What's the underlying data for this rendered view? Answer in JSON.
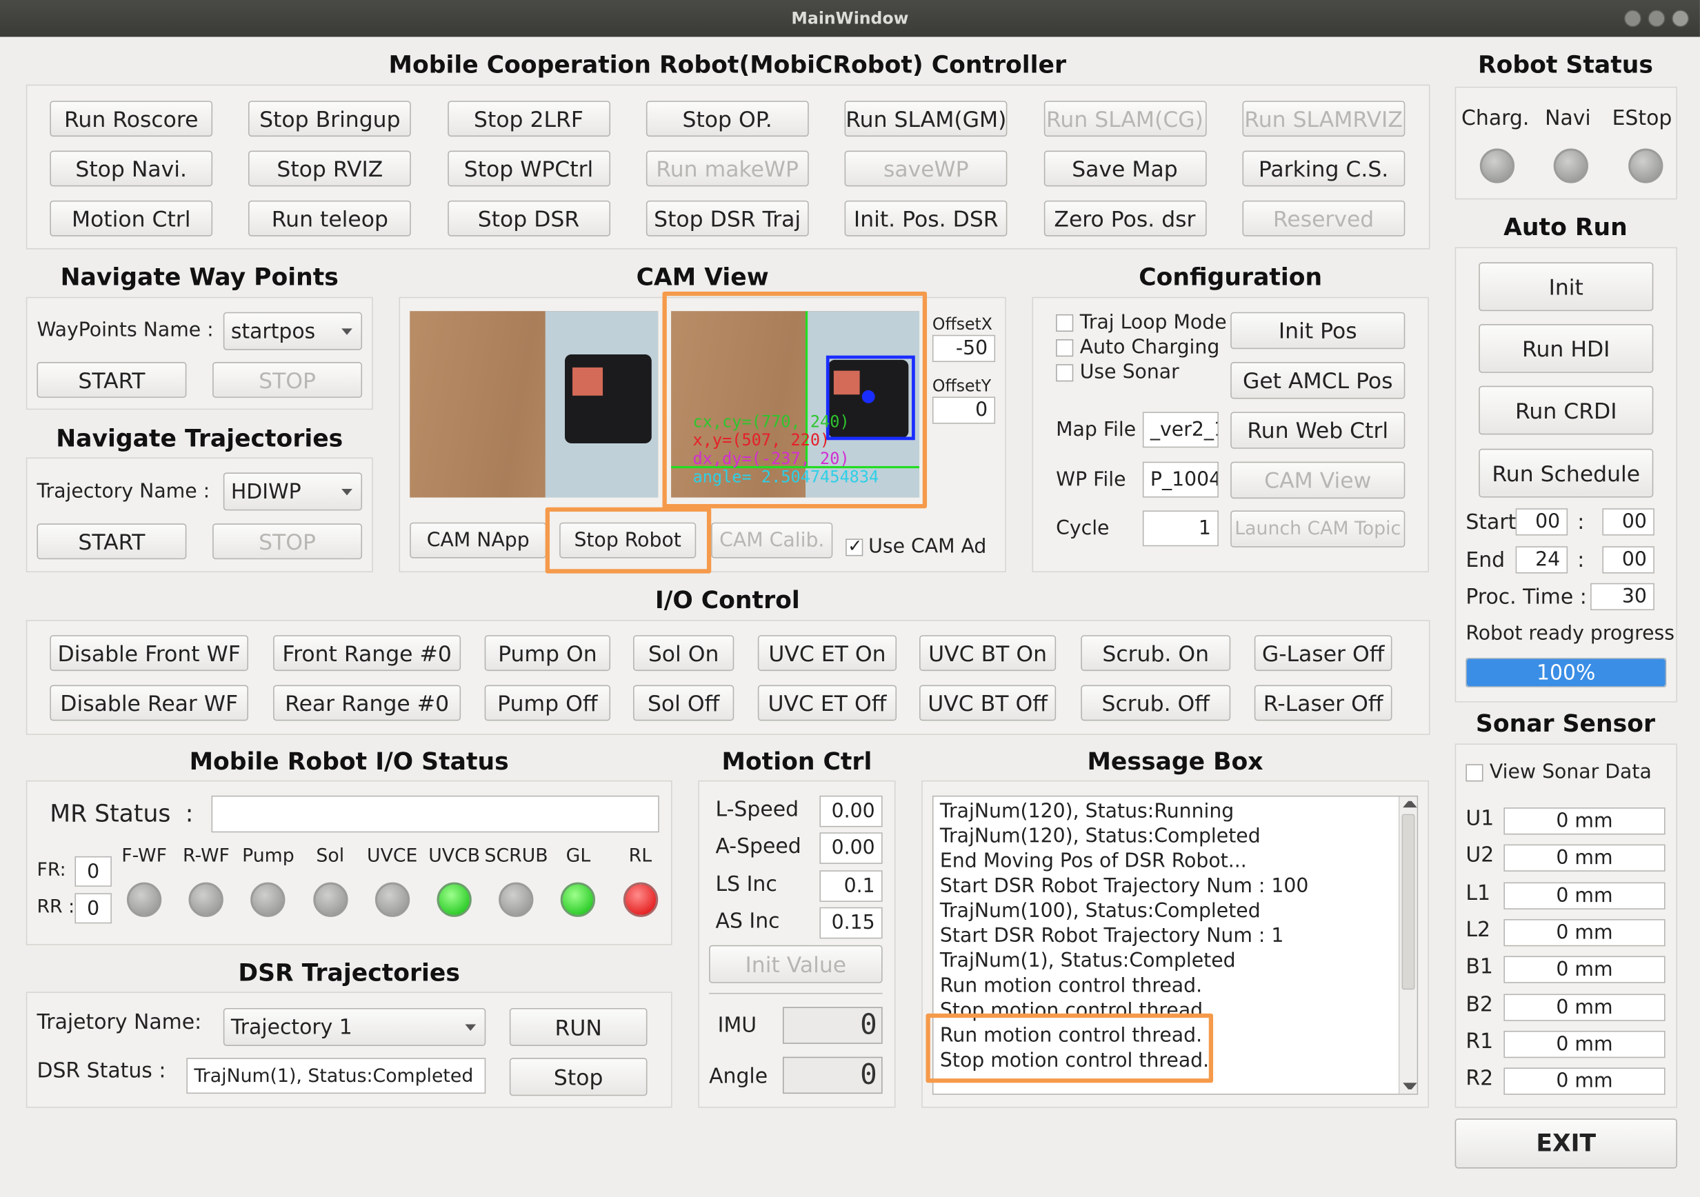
{
  "window": {
    "title": "MainWindow"
  },
  "controller": {
    "title": "Mobile Cooperation Robot(MobiCRobot) Controller",
    "buttons": [
      "Run Roscore",
      "Stop Bringup",
      "Stop 2LRF",
      "Stop OP.",
      "Run SLAM(GM)",
      "Run SLAM(CG)",
      "Run SLAMRVIZ",
      "Stop Navi.",
      "Stop RVIZ",
      "Stop WPCtrl",
      "Run makeWP",
      "saveWP",
      "Save Map",
      "Parking C.S.",
      "Motion Ctrl",
      "Run teleop",
      "Stop DSR",
      "Stop DSR Traj",
      "Init. Pos. DSR",
      "Zero Pos. dsr",
      "Reserved"
    ]
  },
  "robot_status": {
    "title": "Robot Status",
    "labels": [
      "Charg.",
      "Navi",
      "EStop"
    ]
  },
  "auto_run": {
    "title": "Auto Run",
    "buttons": [
      "Init",
      "Run HDI",
      "Run CRDI",
      "Run Schedule"
    ],
    "start_label": "Start",
    "start_h": "00",
    "start_m": "00",
    "end_label": "End",
    "end_h": "24",
    "end_m": "00",
    "colon": ":",
    "proc_label": "Proc. Time :",
    "proc_value": "30",
    "ready_label": "Robot ready progress",
    "progress_text": "100%",
    "progress": 1.0,
    "progress_color": "#3a8ee6"
  },
  "sonar": {
    "title": "Sonar Sensor",
    "view_label": "View Sonar Data",
    "rows": [
      {
        "l": "U1",
        "v": "0 mm"
      },
      {
        "l": "U2",
        "v": "0 mm"
      },
      {
        "l": "L1",
        "v": "0 mm"
      },
      {
        "l": "L2",
        "v": "0 mm"
      },
      {
        "l": "B1",
        "v": "0 mm"
      },
      {
        "l": "B2",
        "v": "0 mm"
      },
      {
        "l": "R1",
        "v": "0 mm"
      },
      {
        "l": "R2",
        "v": "0 mm"
      }
    ]
  },
  "exit_label": "EXIT",
  "nav_wp": {
    "title": "Navigate Way Points",
    "name_label": "WayPoints Name :",
    "value": "startpos",
    "start": "START",
    "stop": "STOP"
  },
  "nav_traj": {
    "title": "Navigate Trajectories",
    "name_label": "Trajectory Name :",
    "value": "HDIWP",
    "start": "START",
    "stop": "STOP"
  },
  "cam": {
    "title": "CAM View",
    "offx_label": "OffsetX",
    "offx": "-50",
    "offy_label": "OffsetY",
    "offy": "0",
    "overlay": [
      "cx,cy=(770, 240)",
      "x,y=(507, 220)",
      "dx,dy=(-237, 20)",
      "angle= 2.5047454834"
    ],
    "napp": "CAM NApp",
    "stop_robot": "Stop Robot",
    "calib": "CAM Calib.",
    "use_ad": "Use CAM Ad"
  },
  "config": {
    "title": "Configuration",
    "checks": [
      "Traj Loop Mode",
      "Auto Charging",
      "Use Sonar"
    ],
    "init_pos": "Init Pos",
    "amcl": "Get AMCL Pos",
    "map_label": "Map File",
    "map_val": "_ver2_1",
    "web": "Run Web Ctrl",
    "wp_label": "WP File",
    "wp_val": "P_1004",
    "cam_view": "CAM View",
    "cycle_label": "Cycle",
    "cycle_val": "1",
    "launch": "Launch CAM Topic"
  },
  "io_ctrl": {
    "title": "I/O Control",
    "buttons": [
      "Disable Front WF",
      "Front Range #0",
      "Pump On",
      "Sol On",
      "UVC ET On",
      "UVC BT On",
      "Scrub. On",
      "G-Laser Off",
      "Disable Rear WF",
      "Rear Range #0",
      "Pump Off",
      "Sol Off",
      "UVC ET Off",
      "UVC BT Off",
      "Scrub. Off",
      "R-Laser Off"
    ]
  },
  "io_status": {
    "title": "Mobile Robot I/O Status",
    "mr_label": "MR Status",
    "colon": ":",
    "mr_value": "",
    "fr_label": "FR:",
    "fr_val": "0",
    "rr_label": "RR :",
    "rr_val": "0",
    "leds": [
      {
        "label": "F-WF",
        "state": "off"
      },
      {
        "label": "R-WF",
        "state": "off"
      },
      {
        "label": "Pump",
        "state": "off"
      },
      {
        "label": "Sol",
        "state": "off"
      },
      {
        "label": "UVCE",
        "state": "off"
      },
      {
        "label": "UVCB",
        "state": "green"
      },
      {
        "label": "SCRUB",
        "state": "off"
      },
      {
        "label": "GL",
        "state": "green"
      },
      {
        "label": "RL",
        "state": "red"
      }
    ]
  },
  "dsr": {
    "title": "DSR Trajectories",
    "name_label": "Trajetory Name:",
    "value": "Trajectory 1",
    "run": "RUN",
    "status_label": "DSR Status :",
    "status_val": "TrajNum(1), Status:Completed",
    "stop": "Stop"
  },
  "motion": {
    "title": "Motion Ctrl",
    "rows": [
      {
        "l": "L-Speed",
        "v": "0.00"
      },
      {
        "l": "A-Speed",
        "v": "0.00"
      },
      {
        "l": "LS Inc",
        "v": "0.1"
      },
      {
        "l": "AS Inc",
        "v": "0.15"
      }
    ],
    "init_value": "Init Value",
    "imu_label": "IMU",
    "imu_val": "0",
    "angle_label": "Angle",
    "angle_val": "0"
  },
  "message": {
    "title": "Message Box",
    "lines": [
      "TrajNum(120), Status:Running",
      "TrajNum(120), Status:Completed",
      "End Moving Pos of DSR Robot...",
      "Start DSR Robot Trajectory Num : 100",
      "TrajNum(100), Status:Completed",
      "Start DSR Robot Trajectory Num : 1",
      "TrajNum(1), Status:Completed",
      "Run motion control thread.",
      "Stop motion control thread.",
      "Run motion control thread.",
      "Stop motion control thread."
    ]
  }
}
